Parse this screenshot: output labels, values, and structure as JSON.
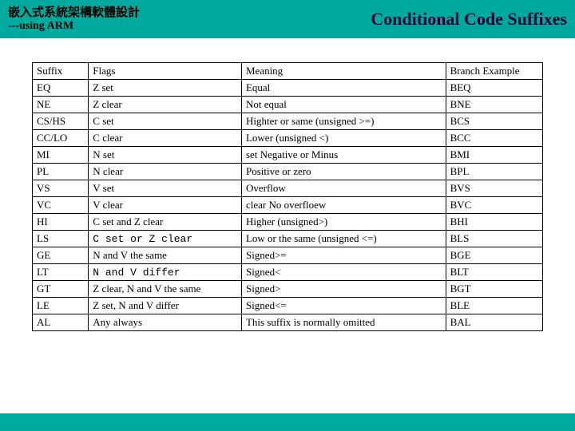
{
  "header": {
    "title_cn": "嵌入式系統架構軟體設計",
    "subtitle": "---using ARM",
    "slide_title": "Conditional Code Suffixes"
  },
  "table": {
    "headers": {
      "c1": "Suffix",
      "c2": "Flags",
      "c3": "Meaning",
      "c4": "Branch Example"
    },
    "rows": [
      {
        "c1": "EQ",
        "c2": "Z set",
        "c3": "Equal",
        "c4": "BEQ"
      },
      {
        "c1": "NE",
        "c2": "Z clear",
        "c3": "Not equal",
        "c4": "BNE"
      },
      {
        "c1": "CS/HS",
        "c2": "C set",
        "c3": "Highter or same (unsigned >=)",
        "c4": "BCS"
      },
      {
        "c1": "CC/LO",
        "c2": "C clear",
        "c3": "Lower (unsigned <)",
        "c4": "BCC"
      },
      {
        "c1": "MI",
        "c2": "N set",
        "c3": "set Negative or Minus",
        "c4": "BMI"
      },
      {
        "c1": "PL",
        "c2": "N clear",
        "c3": "Positive or zero",
        "c4": "BPL"
      },
      {
        "c1": "VS",
        "c2": "V set",
        "c3": "Overflow",
        "c4": "BVS"
      },
      {
        "c1": "VC",
        "c2": "V clear",
        "c3": "clear No overfloew",
        "c4": "BVC"
      },
      {
        "c1": "HI",
        "c2": "C set and Z clear",
        "c3": "Higher (unsigned>)",
        "c4": "BHI"
      },
      {
        "c1": "LS",
        "c2": "C set or Z clear",
        "c2mono": true,
        "c3": "Low or the same (unsigned <=)",
        "c4": "BLS"
      },
      {
        "c1": "GE",
        "c2": "N and V the same",
        "c3": "Signed>=",
        "c4": "BGE"
      },
      {
        "c1": "LT",
        "c2": "N and V differ",
        "c2mono": true,
        "c3": "Signed<",
        "c4": "BLT"
      },
      {
        "c1": "GT",
        "c2": "Z clear, N and V the same",
        "c3": "Signed>",
        "c4": "BGT"
      },
      {
        "c1": "LE",
        "c2": "Z set, N and V differ",
        "c3": "Signed<=",
        "c4": "BLE"
      },
      {
        "c1": "AL",
        "c2": "Any always",
        "c3": "This suffix is normally omitted",
        "c4": "BAL"
      }
    ]
  }
}
